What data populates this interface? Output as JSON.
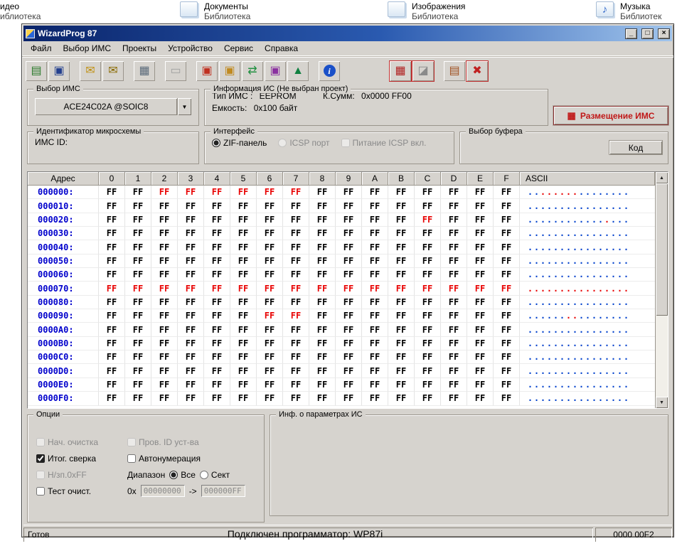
{
  "desktop": {
    "libraries": [
      {
        "name": "идео",
        "type": "иблиотека",
        "icon": "video-library-icon",
        "show_icon": false,
        "glyph": ""
      },
      {
        "name": "Документы",
        "type": "Библиотека",
        "icon": "documents-library-icon",
        "show_icon": true,
        "glyph": ""
      },
      {
        "name": "Изображения",
        "type": "Библиотека",
        "icon": "pictures-library-icon",
        "show_icon": true,
        "glyph": ""
      },
      {
        "name": "Музыка",
        "type": "Библиотек",
        "icon": "music-library-icon",
        "show_icon": true,
        "glyph": "♪"
      }
    ]
  },
  "window": {
    "title": "WizardProg 87",
    "minimize_glyph": "_",
    "maximize_glyph": "□",
    "close_glyph": "×"
  },
  "menu": [
    "Файл",
    "Выбор ИМС",
    "Проекты",
    "Устройство",
    "Сервис",
    "Справка"
  ],
  "toolbar": [
    {
      "name": "open-buffer-button",
      "glyph": "▤",
      "color": "#2a7a2a"
    },
    {
      "name": "save-buffer-button",
      "glyph": "▣",
      "color": "#24408e"
    },
    {
      "spacer": true,
      "size": 10
    },
    {
      "name": "open-project-button",
      "glyph": "✉",
      "color": "#c09010"
    },
    {
      "name": "save-project-button",
      "glyph": "✉",
      "color": "#8a6a00"
    },
    {
      "spacer": true,
      "size": 10
    },
    {
      "name": "checksum-button",
      "glyph": "▦",
      "color": "#5a6a7a"
    },
    {
      "spacer": true,
      "size": 10
    },
    {
      "name": "socket-test-button",
      "glyph": "▭",
      "color": "#9a9a9a",
      "disabled": true
    },
    {
      "spacer": true,
      "size": 10
    },
    {
      "name": "read-chip-button",
      "glyph": "▣",
      "color": "#c03020"
    },
    {
      "name": "write-chip-button",
      "glyph": "▣",
      "color": "#c08a20"
    },
    {
      "name": "verify-chip-button",
      "glyph": "⇄",
      "color": "#209040"
    },
    {
      "name": "erase-chip-button",
      "glyph": "▣",
      "color": "#8a30a0"
    },
    {
      "name": "program-chip-button",
      "glyph": "▲",
      "color": "#108040"
    },
    {
      "spacer": true,
      "size": 10
    },
    {
      "name": "info-button",
      "glyph": "i",
      "color": "#ffffff",
      "badge": "#1a50c8"
    },
    {
      "spacer": true,
      "size": 66
    },
    {
      "name": "chip-placement-button",
      "glyph": "▦",
      "color": "#b02020",
      "frame": true
    },
    {
      "name": "buffer-editor-button",
      "glyph": "◪",
      "color": "#8a8a8a",
      "frame": true
    },
    {
      "spacer": true,
      "size": 10
    },
    {
      "name": "report-button",
      "glyph": "▤",
      "color": "#a05020"
    },
    {
      "name": "exit-button",
      "glyph": "✖",
      "color": "#c02020",
      "frame": true
    }
  ],
  "chip_select": {
    "title": "Выбор ИМС",
    "value": "ACE24C02A @SOIC8",
    "dropdown_glyph": "▼"
  },
  "chip_info": {
    "title": "Информация ИС (Не выбран проект)",
    "type_label": "Тип ИМС :",
    "type_value": "EEPROM",
    "checksum_label": "К.Сумм:",
    "checksum_value": "0x0000 FF00",
    "capacity_label": "Емкость:",
    "capacity_value": "0x100 байт"
  },
  "placement_button": {
    "label": "Размещение ИМС",
    "glyph": "▦"
  },
  "chip_id": {
    "title": "Идентификатор микросхемы",
    "label": "ИМС ID:"
  },
  "interface": {
    "title": "Интерфейс",
    "radios": [
      {
        "label": "ZIF-панель",
        "selected": true,
        "disabled": false
      },
      {
        "label": "ICSP порт",
        "selected": false,
        "disabled": true
      }
    ],
    "power_checkbox": {
      "label": "Питание ICSP вкл.",
      "checked": false,
      "disabled": true
    }
  },
  "buffer_select": {
    "title": "Выбор буфера",
    "button_label": "Код"
  },
  "hex_grid": {
    "columns": [
      "Адрес",
      "0",
      "1",
      "2",
      "3",
      "4",
      "5",
      "6",
      "7",
      "8",
      "9",
      "A",
      "B",
      "C",
      "D",
      "E",
      "F",
      "ASCII"
    ],
    "cell_value": "FF",
    "ascii_char": ".",
    "rows": [
      {
        "address": "000000:",
        "red": [
          2,
          3,
          4,
          5,
          6,
          7
        ]
      },
      {
        "address": "000010:",
        "red": []
      },
      {
        "address": "000020:",
        "red": [
          12
        ]
      },
      {
        "address": "000030:",
        "red": []
      },
      {
        "address": "000040:",
        "red": []
      },
      {
        "address": "000050:",
        "red": []
      },
      {
        "address": "000060:",
        "red": []
      },
      {
        "address": "000070:",
        "red": [
          0,
          1,
          2,
          3,
          4,
          5,
          6,
          7,
          8,
          9,
          10,
          11,
          12,
          13,
          14,
          15
        ]
      },
      {
        "address": "000080:",
        "red": []
      },
      {
        "address": "000090:",
        "red": [
          6,
          7
        ]
      },
      {
        "address": "0000A0:",
        "red": []
      },
      {
        "address": "0000B0:",
        "red": []
      },
      {
        "address": "0000C0:",
        "red": []
      },
      {
        "address": "0000D0:",
        "red": []
      },
      {
        "address": "0000E0:",
        "red": []
      },
      {
        "address": "0000F0:",
        "red": []
      }
    ]
  },
  "scrollbar": {
    "up_glyph": "▲",
    "down_glyph": "▼"
  },
  "options": {
    "title": "Опции",
    "left_checkboxes": [
      {
        "label": "Нач. очистка",
        "checked": false,
        "disabled": true
      },
      {
        "label": "Итог. сверка",
        "checked": true,
        "disabled": false
      },
      {
        "label": "Н/зп.0xFF",
        "checked": false,
        "disabled": true
      },
      {
        "label": "Тест очист.",
        "checked": false,
        "disabled": false
      }
    ],
    "right_checkboxes": [
      {
        "label": "Пров. ID уст-ва",
        "checked": false,
        "disabled": true
      },
      {
        "label": "Автонумерация",
        "checked": false,
        "disabled": false
      }
    ],
    "range_label": "Диапазон",
    "range_radios": [
      {
        "label": "Все",
        "selected": true,
        "disabled": false
      },
      {
        "label": "Сект",
        "selected": false,
        "disabled": false
      }
    ],
    "hex_prefix": "0x",
    "from_value": "00000000",
    "arrow": "->",
    "to_value": "000000FF"
  },
  "info_params": {
    "title": "Инф. о параметрах ИС"
  },
  "statusbar": {
    "left": "Готов",
    "center": "Подключен программатор: WP87i",
    "right": "0000 00F2"
  },
  "colors": {
    "address_blue": "#0000cc",
    "value_black": "#000000",
    "value_red": "#e80000",
    "accent_red": "#c01818",
    "titlebar_start": "#0a246a",
    "titlebar_end": "#a0c4ec",
    "window_face": "#d6d3ce"
  }
}
